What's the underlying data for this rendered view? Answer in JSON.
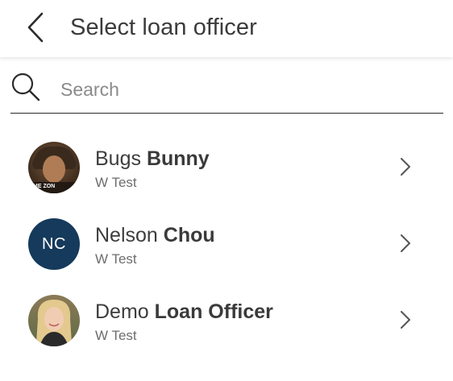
{
  "header": {
    "title": "Select loan officer",
    "back_icon": "chevron-left-icon"
  },
  "search": {
    "placeholder": "Search",
    "value": "",
    "icon": "search-icon"
  },
  "officers": [
    {
      "first": "Bugs",
      "last": "Bunny",
      "subtitle": "W Test",
      "avatar": "photo",
      "avatar_caption": "ME ZON"
    },
    {
      "first": "Nelson",
      "last": "Chou",
      "subtitle": "W Test",
      "avatar": "initials",
      "initials": "NC",
      "avatar_color": "#153a5b"
    },
    {
      "first": "Demo",
      "last": "Loan Officer",
      "subtitle": "W Test",
      "avatar": "photo"
    }
  ],
  "colors": {
    "text_primary": "#3b3b3b",
    "text_secondary": "#6d6d6d",
    "initials_bg": "#153a5b"
  }
}
